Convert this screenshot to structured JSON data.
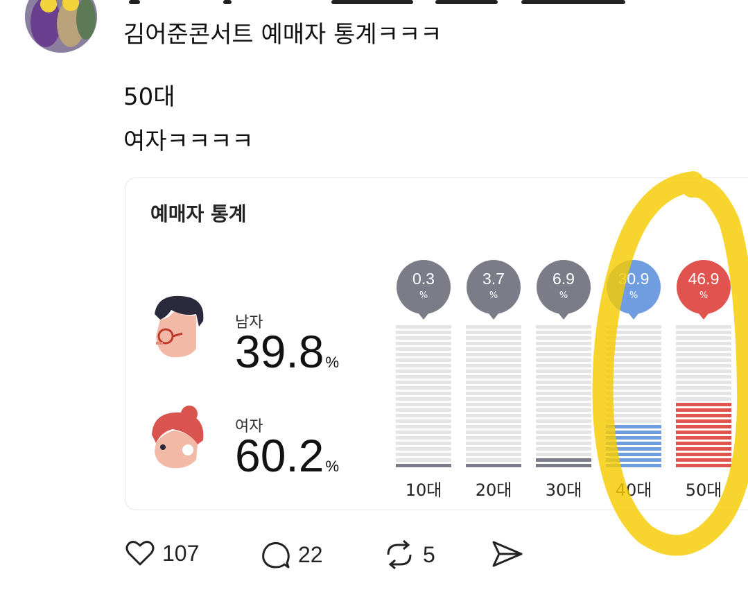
{
  "post": {
    "title_line": "김어준콘서트 예매자 통계ㅋㅋㅋ",
    "line2": "50대",
    "line3": "여자ㅋㅋㅋㅋ"
  },
  "card": {
    "title": "예매자 통계",
    "male_label": "남자",
    "male_value": "39.8",
    "female_label": "여자",
    "female_value": "60.2",
    "percent_symbol": "%"
  },
  "chart_data": {
    "type": "bar",
    "title": "",
    "categories": [
      "10대",
      "20대",
      "30대",
      "40대",
      "50대"
    ],
    "values": [
      0.3,
      3.7,
      6.9,
      30.9,
      46.9
    ],
    "value_labels": [
      "0.3",
      "3.7",
      "6.9",
      "30.9",
      "46.9"
    ],
    "unit": "%",
    "colors": [
      "#7c7c88",
      "#7c7c88",
      "#7c7c88",
      "#6f9de0",
      "#e0534f"
    ],
    "ylim": [
      0,
      100
    ]
  },
  "actions": {
    "likes": "107",
    "comments": "22",
    "reposts": "5"
  },
  "colors": {
    "highlight": "#f5cc00",
    "male_hair": "#2b2a3c",
    "female_hair": "#d9534f",
    "skin": "#f2b9a6"
  }
}
